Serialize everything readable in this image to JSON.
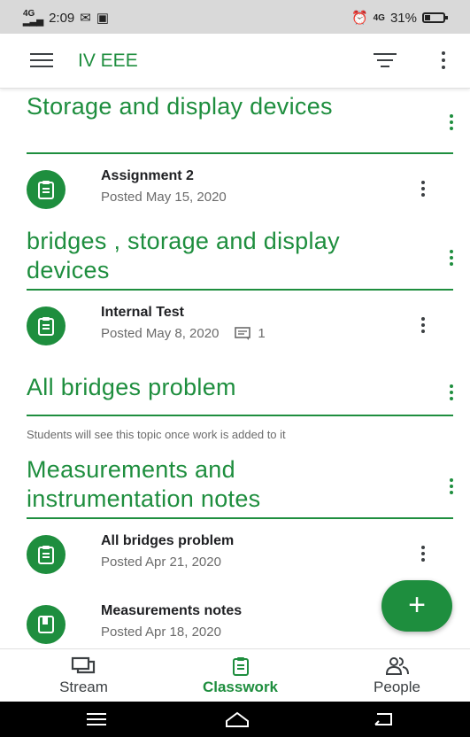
{
  "status_bar": {
    "network": "4G",
    "time": "2:09",
    "network_right": "4G",
    "battery": "31%",
    "battery_level": 0.31
  },
  "app_bar": {
    "title": "IV EEE"
  },
  "topics": [
    {
      "title": "Storage and display devices"
    },
    {
      "title": "bridges , storage and display devices"
    },
    {
      "title": "All bridges problem"
    },
    {
      "title": "Measurements and instrumentation notes"
    }
  ],
  "items": [
    {
      "title": "Assignment 2",
      "posted": "Posted May 15, 2020",
      "icon": "assignment-icon"
    },
    {
      "title": "Internal Test",
      "posted": "Posted May 8, 2020",
      "comments": "1",
      "icon": "assignment-icon"
    },
    {
      "title": "All bridges problem",
      "posted": "Posted Apr 21, 2020",
      "icon": "assignment-icon"
    },
    {
      "title": "Measurements notes",
      "posted": "Posted Apr 18, 2020",
      "icon": "material-icon"
    }
  ],
  "empty_topic_note": "Students will see this topic once work is added to it",
  "fab": {
    "label": "+"
  },
  "bottom_nav": {
    "stream": "Stream",
    "classwork": "Classwork",
    "people": "People"
  },
  "colors": {
    "accent": "#1e8e3e",
    "text": "#202124",
    "muted": "#6b6b6b"
  }
}
